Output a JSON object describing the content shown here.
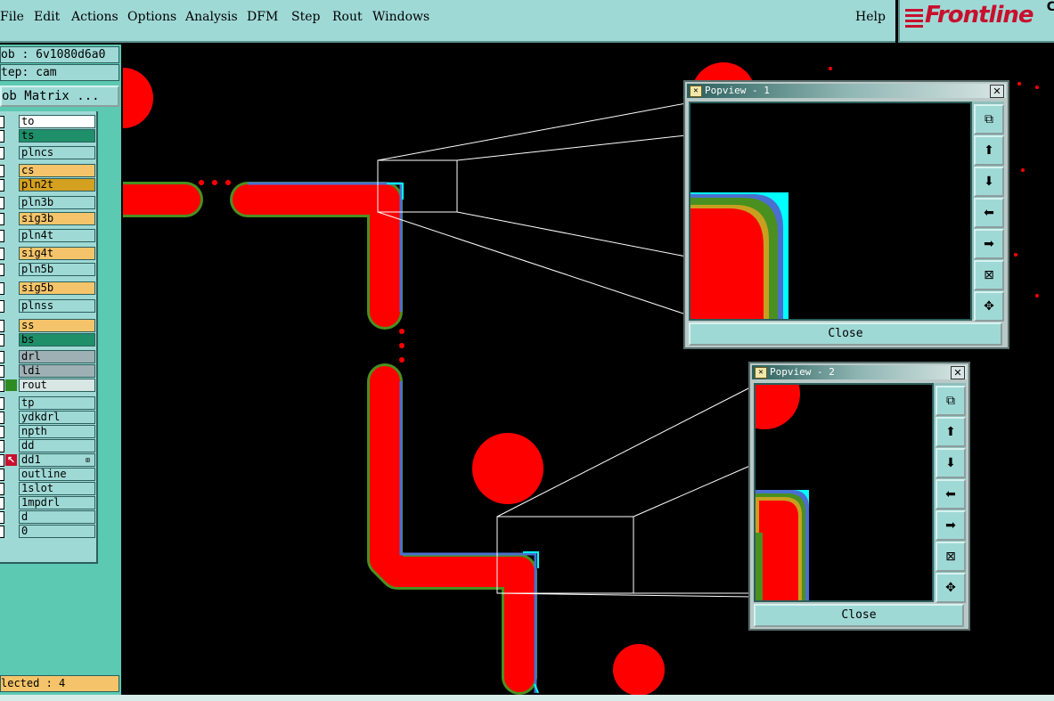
{
  "menu": {
    "file": "File",
    "edit": "Edit",
    "actions": "Actions",
    "options": "Options",
    "analysis": "Analysis",
    "dfm": "DFM",
    "step": "Step",
    "rout": "Rout",
    "windows": "Windows",
    "help": "Help"
  },
  "logo": {
    "text": "Frontline",
    "cutoff": "C"
  },
  "sidebar": {
    "job": "ob : 6v1080d6a0",
    "step": "tep: cam",
    "matrix_button": "ob Matrix ...",
    "selected": "lected : 4"
  },
  "layers": [
    {
      "name": "to",
      "color": "#ffffff"
    },
    {
      "name": "ts",
      "color": "#1f8f6a"
    },
    {
      "name": "plncs",
      "color": "#9fd9d6"
    },
    {
      "name": "cs",
      "color": "#f5c46a"
    },
    {
      "name": "pln2t",
      "color": "#d4a020"
    },
    {
      "name": "pln3b",
      "color": "#9fd9d6"
    },
    {
      "name": "sig3b",
      "color": "#f5c46a"
    },
    {
      "name": "pln4t",
      "color": "#9fd9d6"
    },
    {
      "name": "sig4t",
      "color": "#f5c46a"
    },
    {
      "name": "pln5b",
      "color": "#9fd9d6"
    },
    {
      "name": "sig5b",
      "color": "#f5c46a"
    },
    {
      "name": "plnss",
      "color": "#9fd9d6"
    },
    {
      "name": "ss",
      "color": "#f5c46a"
    },
    {
      "name": "bs",
      "color": "#1f8f6a"
    },
    {
      "name": "drl",
      "color": "#9fb0b4"
    },
    {
      "name": "ldi",
      "color": "#9fb0b4"
    },
    {
      "name": "rout",
      "color": "#d8e6e4"
    },
    {
      "name": "tp",
      "color": "#9fd9d6"
    },
    {
      "name": "ydkdrl",
      "color": "#9fd9d6"
    },
    {
      "name": "npth",
      "color": "#9fd9d6"
    },
    {
      "name": "dd",
      "color": "#9fd9d6"
    },
    {
      "name": "dd1",
      "color": "#9fd9d6"
    },
    {
      "name": "outline",
      "color": "#9fd9d6"
    },
    {
      "name": "1slot",
      "color": "#9fd9d6"
    },
    {
      "name": "1mpdrl",
      "color": "#9fd9d6"
    },
    {
      "name": "d",
      "color": "#9fd9d6"
    },
    {
      "name": "0",
      "color": "#9fd9d6"
    }
  ],
  "popview1": {
    "title": "Popview - 1",
    "close_label": "Close"
  },
  "popview2": {
    "title": "Popview - 2",
    "close_label": "Close"
  },
  "popview_tool_icons": [
    "zoom-window-icon",
    "pan-up-icon",
    "pan-down-icon",
    "pan-left-icon",
    "pan-right-icon",
    "zoom-in-icon",
    "zoom-out-icon"
  ],
  "colors": {
    "pad": "#ff0000",
    "trace_outline": "#4a9020",
    "rout_path": "#4a6fd0",
    "selection": "#00ffff",
    "panel": "#9fd9d6",
    "sidebar": "#5cc9b2"
  }
}
